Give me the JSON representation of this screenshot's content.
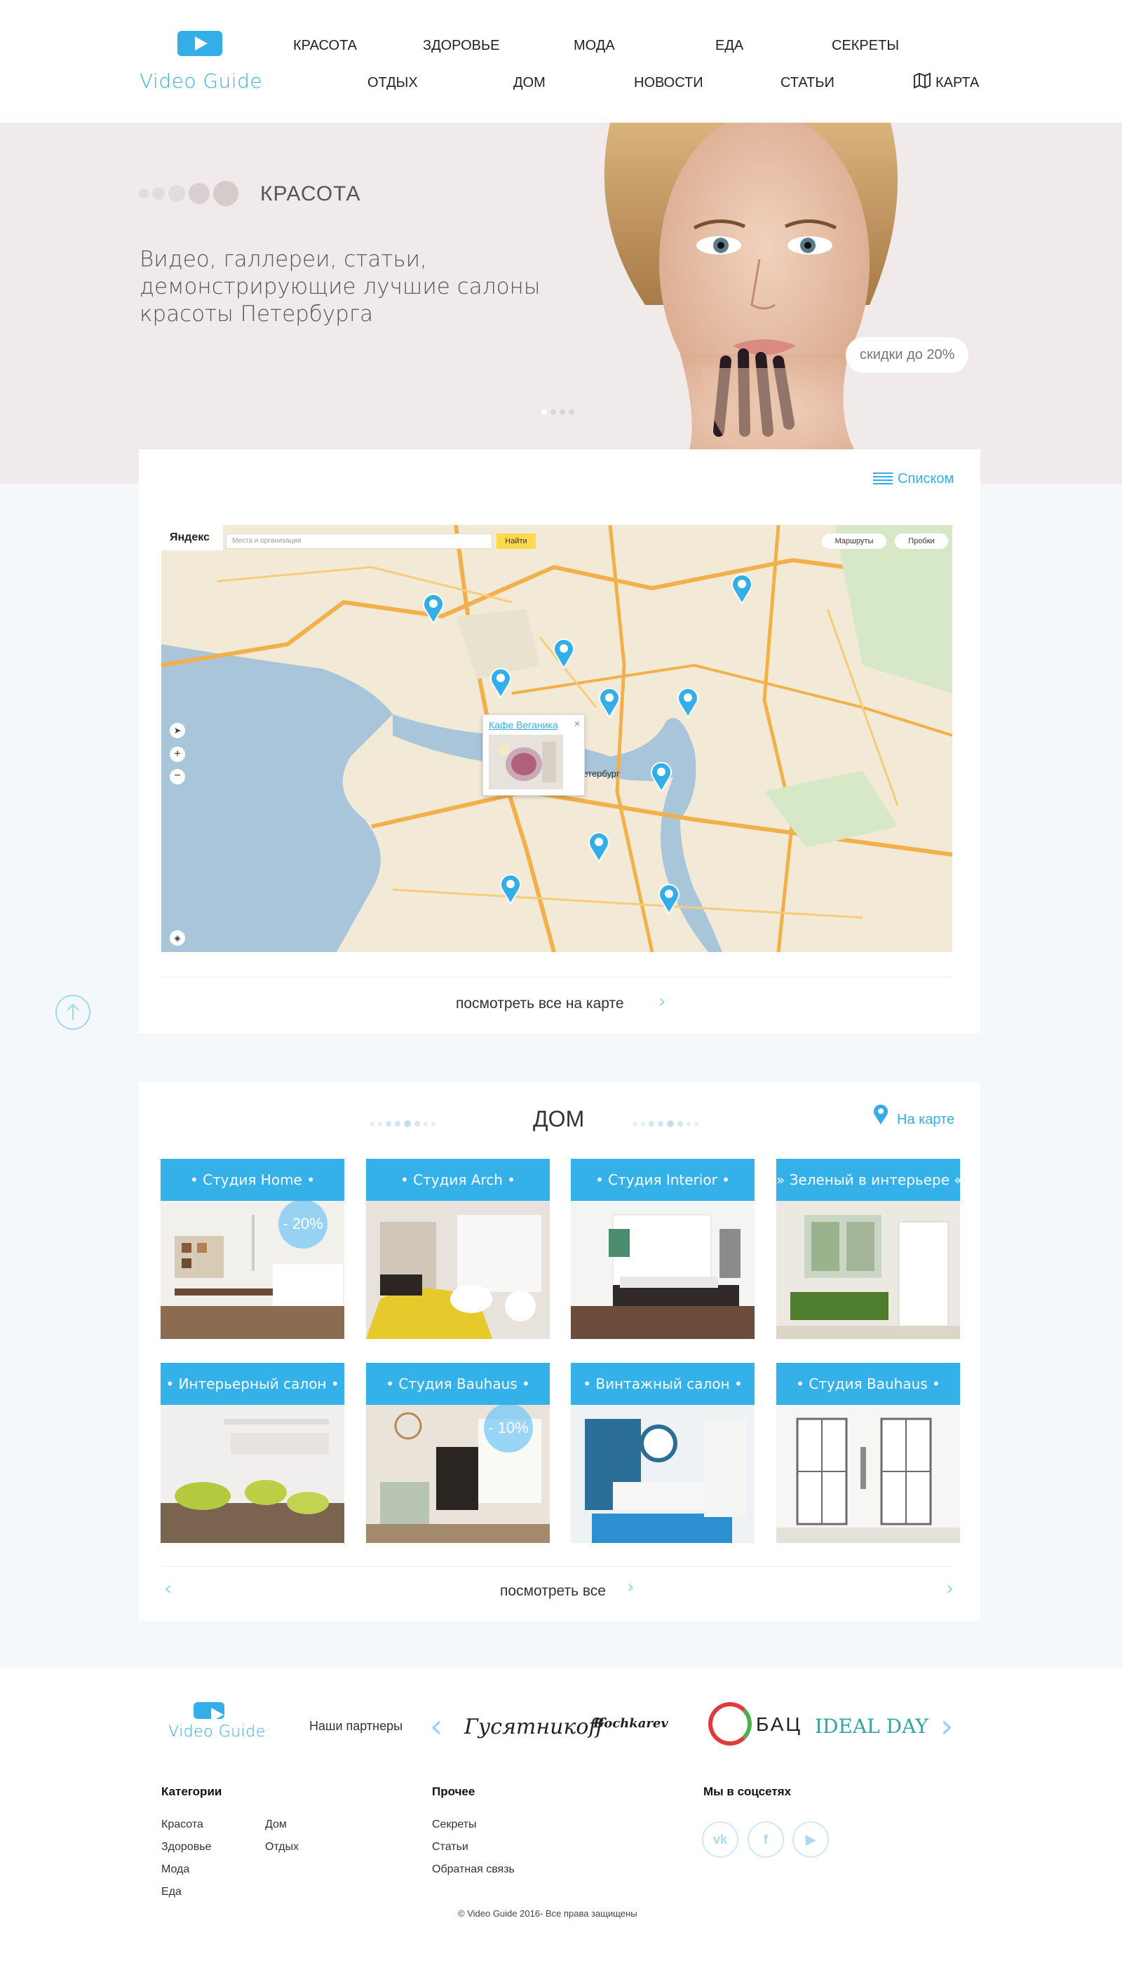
{
  "brand": {
    "name": "Video Guide",
    "color": "#33aee8"
  },
  "nav": {
    "row1": [
      "КРАСОТА",
      "ЗДОРОВЬЕ",
      "МОДА",
      "ЕДА",
      "СЕКРЕТЫ"
    ],
    "row2": [
      "ОТДЫХ",
      "ДОМ",
      "НОВОСТИ",
      "СТАТЬИ",
      "КАРТА"
    ]
  },
  "hero": {
    "category": "КРАСОТА",
    "text_lines": [
      "Видео, галлереи, статьи,",
      "демонстрирующие лучшие салоны",
      "красоты Петербурга"
    ],
    "discount": "скидки до 20%"
  },
  "map_section": {
    "list_link": "Списком",
    "map_brand": "Яндекс",
    "search_placeholder": "Места и организации",
    "search_button": "Найти",
    "routes": "Маршруты",
    "traffic": "Пробки",
    "popup_title": "Кафе Веганика",
    "city_label": "Петербург",
    "view_all": "посмотреть все на карте"
  },
  "home_section": {
    "title": "ДОМ",
    "map_link": "На карте",
    "view_all": "посмотреть все",
    "tiles": [
      {
        "label": "• Студия Home •",
        "badge": "- 20%"
      },
      {
        "label": "• Студия Arch •",
        "badge": ""
      },
      {
        "label": "• Студия Interior •",
        "badge": ""
      },
      {
        "label": "» Зеленый в интерьере «",
        "badge": ""
      },
      {
        "label": "• Интерьерный салон •",
        "badge": ""
      },
      {
        "label": "• Студия Bauhaus •",
        "badge": "- 10%"
      },
      {
        "label": "• Винтажный салон •",
        "badge": ""
      },
      {
        "label": "• Студия Bauhaus •",
        "badge": ""
      }
    ]
  },
  "partners": {
    "label": "Наши партнеры",
    "logos": [
      "Гусятникоff",
      "Bochkarev",
      "БАЦ",
      "IDEAL DAY"
    ]
  },
  "footer": {
    "categories_title": "Категории",
    "categories_col1": [
      "Красота",
      "Здоровье",
      "Мода",
      "Еда"
    ],
    "categories_col2": [
      "Дом",
      "Отдых"
    ],
    "other_title": "Прочее",
    "other_links": [
      "Секреты",
      "Статьи",
      "Обратная связь"
    ],
    "social_title": "Мы в соцсетях",
    "social": [
      "vk-icon",
      "facebook-icon",
      "youtube-icon"
    ],
    "copyright": "© Video Guide 2016- Все права защищены"
  }
}
